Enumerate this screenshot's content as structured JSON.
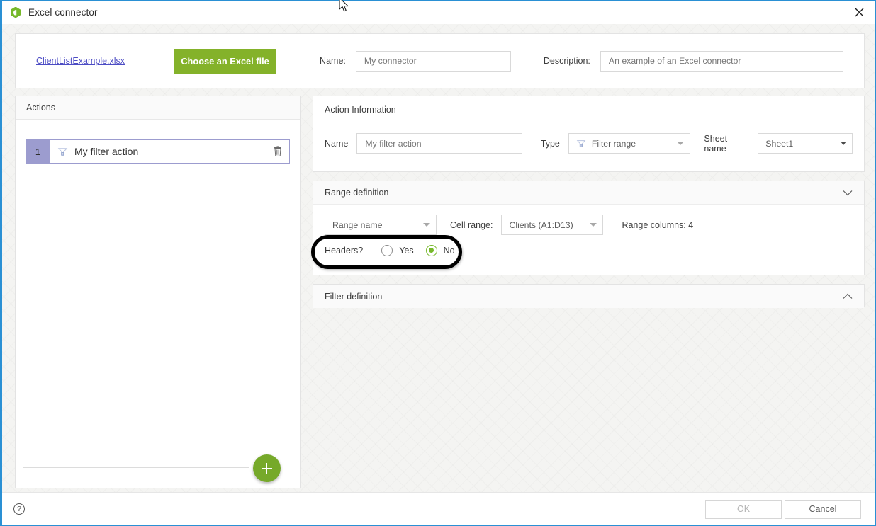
{
  "window": {
    "title": "Excel connector",
    "icon": "excel-connector-icon",
    "close_label": "✕"
  },
  "header": {
    "file_link": "ClientListExample.xlsx",
    "choose_file_label": "Choose an Excel file",
    "name_label": "Name:",
    "name_value": "My connector",
    "description_label": "Description:",
    "description_value": "An example of an Excel connector"
  },
  "actions_panel": {
    "title": "Actions",
    "rows": [
      {
        "index": "1",
        "name": "My filter action",
        "icon": "filter-range-icon",
        "delete_icon": "trash-icon"
      }
    ],
    "add_label": "+"
  },
  "action_information": {
    "title": "Action Information",
    "name_label": "Name",
    "name_value": "My filter action",
    "type_label": "Type",
    "type_value": "Filter range",
    "sheet_label": "Sheet name",
    "sheet_value": "Sheet1"
  },
  "range_definition": {
    "title": "Range definition",
    "chevron": "chevron-down-icon",
    "range_kind_value": "Range name",
    "cell_range_label": "Cell range:",
    "cell_range_value": "Clients (A1:D13)",
    "range_columns_text": "Range columns: 4",
    "headers_label": "Headers?",
    "headers_options": [
      {
        "label": "Yes",
        "selected": false
      },
      {
        "label": "No",
        "selected": true
      }
    ]
  },
  "filter_definition": {
    "title": "Filter definition",
    "chevron": "chevron-up-icon"
  },
  "footer": {
    "help_label": "?",
    "ok_label": "OK",
    "cancel_label": "Cancel"
  },
  "colors": {
    "accent_green": "#84b22a",
    "add_button_green": "#76a92a",
    "radio_green": "#76b82a",
    "window_border_blue": "#2a90d4",
    "row_index_purple": "#9c9ccf",
    "link_purple": "#4c4cc4"
  }
}
